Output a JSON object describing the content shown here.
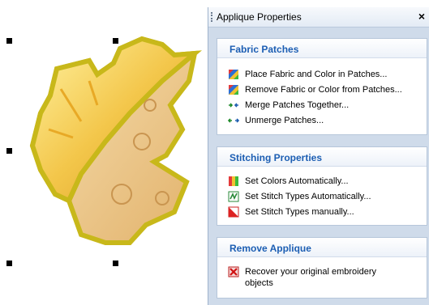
{
  "panel": {
    "title": "Applique Properties",
    "close_label": "×",
    "sections": [
      {
        "title": "Fabric Patches",
        "items": [
          {
            "label": "Place Fabric and Color in Patches...",
            "icon": "fabric-color-icon"
          },
          {
            "label": "Remove Fabric or Color from Patches...",
            "icon": "fabric-color-icon"
          },
          {
            "label": "Merge Patches Together...",
            "icon": "merge-arrows-icon"
          },
          {
            "label": "Unmerge Patches...",
            "icon": "unmerge-arrows-icon"
          }
        ]
      },
      {
        "title": "Stitching Properties",
        "items": [
          {
            "label": "Set Colors Automatically...",
            "icon": "color-bars-icon"
          },
          {
            "label": "Set Stitch Types Automatically...",
            "icon": "stitch-auto-icon"
          },
          {
            "label": "Set Stitch Types manually...",
            "icon": "stitch-manual-icon"
          }
        ]
      },
      {
        "title": "Remove Applique",
        "items": [
          {
            "label": "Recover your original embroidery objects",
            "icon": "red-x-icon"
          }
        ]
      }
    ]
  },
  "colors": {
    "panel_bg": "#cfdbea",
    "section_title": "#1c5eb3",
    "leaf_border": "#c8b81a",
    "leaf_fill": "#f2c14e"
  }
}
